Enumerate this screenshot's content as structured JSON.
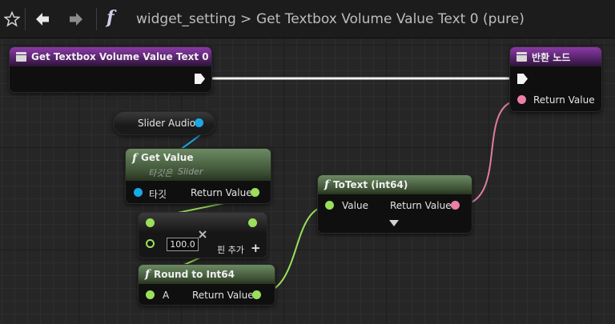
{
  "toolbar": {
    "breadcrumb_parent": "widget_setting",
    "breadcrumb_separator": ">",
    "breadcrumb_current": "Get Textbox Volume Value Text 0 (pure)",
    "function_glyph": "f",
    "icons": [
      "star-icon",
      "back-arrow-icon",
      "forward-arrow-icon",
      "function-icon"
    ]
  },
  "nodes": {
    "entry": {
      "title": "Get Textbox Volume Value Text 0"
    },
    "return": {
      "title": "반환 노드",
      "pin_return_value": "Return Value"
    },
    "slider_audio": {
      "label": "Slider Audio"
    },
    "get_value": {
      "title": "Get Value",
      "target_prefix": "타깃은",
      "target_class": "Slider",
      "pin_target": "타깃",
      "pin_return_value": "Return Value"
    },
    "add": {
      "value": "100.0",
      "add_pin_label": "핀 추가",
      "add_pin_symbol": "+"
    },
    "round": {
      "title": "Round to Int64",
      "pin_a": "A",
      "pin_return_value": "Return Value"
    },
    "to_text": {
      "title": "ToText (int64)",
      "pin_value": "Value",
      "pin_return_value": "Return Value"
    }
  },
  "colors": {
    "exec": "#f4f4f4",
    "float_pin": "#9be05a",
    "object_pin": "#1aa9e6",
    "text_pin": "#ec7fa8",
    "entry_header": "#8a3aa6",
    "function_header": "#6c8a63"
  }
}
